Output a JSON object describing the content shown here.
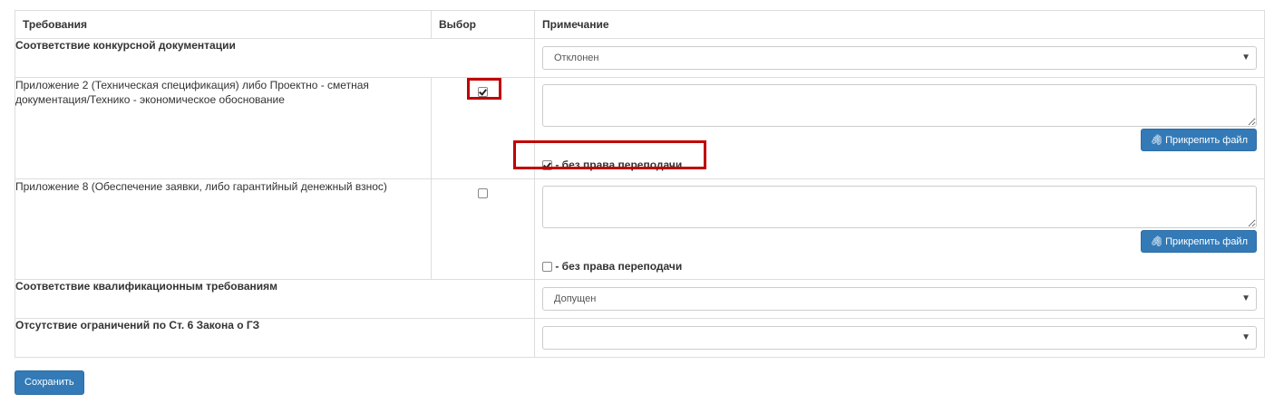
{
  "table": {
    "headers": [
      "Требования",
      "Выбор",
      "Примечание"
    ],
    "rows": [
      {
        "requirement": "Соответствие конкурсной документации",
        "bold": true,
        "select": "Отклонен"
      },
      {
        "requirement": "Приложение 2 (Техническая спецификация) либо Проектно - сметная документация/Технико - экономическое обоснование",
        "checked": true,
        "note": "",
        "attach_label": "Прикрепить файл",
        "no_resubmit_checked": true,
        "no_resubmit_label": "- без права переподачи"
      },
      {
        "requirement": "Приложение 8 (Обеспечение заявки, либо гарантийный денежный взнос)",
        "checked": false,
        "note": "",
        "attach_label": "Прикрепить файл",
        "no_resubmit_checked": false,
        "no_resubmit_label": "- без права переподачи"
      },
      {
        "requirement": "Соответствие квалификационным требованиям",
        "bold": true,
        "select": "Допущен"
      },
      {
        "requirement": "Отсутствие ограничений по Ст. 6 Закона о ГЗ",
        "bold": true,
        "select": ""
      }
    ]
  },
  "save_label": "Сохранить",
  "highlight_color": "#c00000",
  "button_color": "#337ab7"
}
